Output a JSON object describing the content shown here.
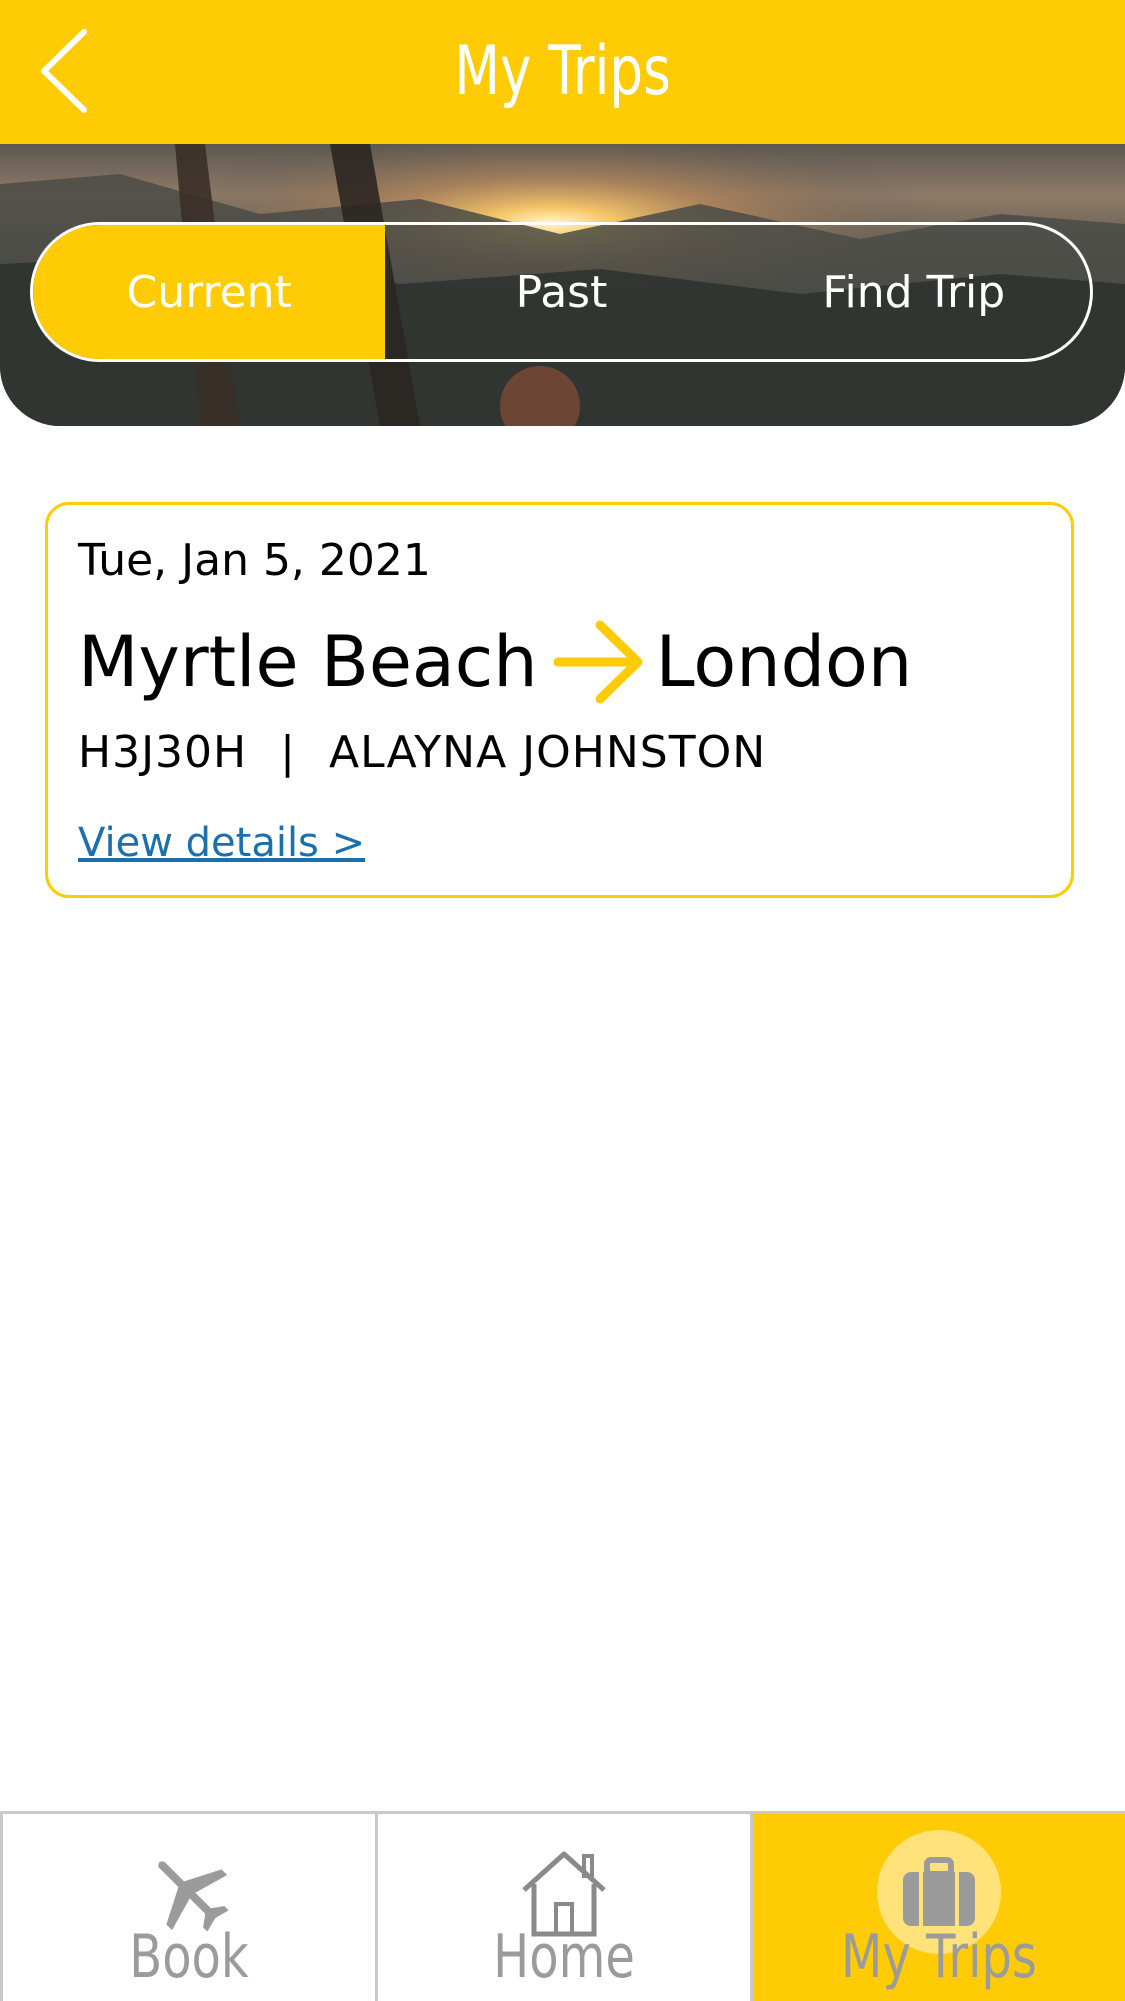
{
  "colors": {
    "brand_yellow": "#FFCB05",
    "link_blue": "#1a6fae",
    "tab_gray": "#9b9b9b"
  },
  "header": {
    "title": "My Trips",
    "back_icon": "chevron-left-icon"
  },
  "segments": [
    {
      "label": "Current",
      "active": true
    },
    {
      "label": "Past",
      "active": false
    },
    {
      "label": "Find Trip",
      "active": false
    }
  ],
  "trip": {
    "date": "Tue, Jan 5, 2021",
    "origin": "Myrtle Beach",
    "destination": "London",
    "arrow_icon": "arrow-right-icon",
    "confirmation": "H3J30H",
    "separator": "|",
    "passenger": "ALAYNA JOHNSTON",
    "details_link": "View details >"
  },
  "tabbar": {
    "items": [
      {
        "label": "Book",
        "icon": "plane-icon",
        "active": false
      },
      {
        "label": "Home",
        "icon": "home-icon",
        "active": false
      },
      {
        "label": "My Trips",
        "icon": "suitcase-icon",
        "active": true
      }
    ]
  }
}
